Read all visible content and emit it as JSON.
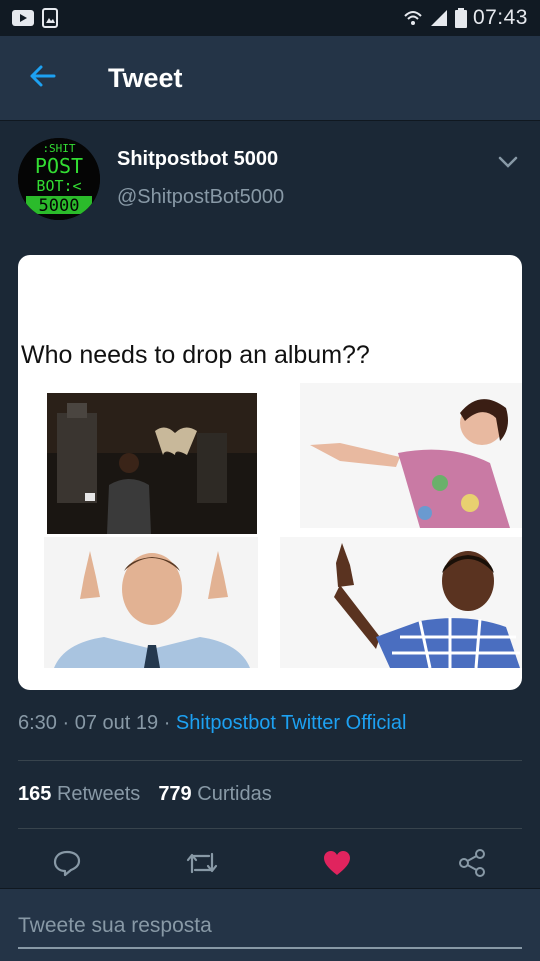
{
  "statusbar": {
    "time": "07:43",
    "icons": [
      "youtube-icon",
      "image-notification-icon",
      "wifi-icon",
      "signal-icon",
      "battery-icon"
    ]
  },
  "appbar": {
    "title": "Tweet",
    "back_icon": "arrow-left-icon",
    "accent": "#1da1f2"
  },
  "author": {
    "display_name": "Shitpostbot 5000",
    "handle": "@ShitpostBot5000",
    "avatar_text": [
      ":SHIT",
      "POST",
      "BOT:<",
      "5000"
    ]
  },
  "media": {
    "caption": "Who needs to drop an album??",
    "panels": [
      "man-with-moth-photo",
      "woman-pointing-photo",
      "man-pointing-up-photo",
      "boy-pointing-photo"
    ]
  },
  "meta": {
    "time": "6:30",
    "date": "07 out 19",
    "source": "Shitpostbot Twitter Official"
  },
  "stats": {
    "retweets_count": "165",
    "retweets_label": "Retweets",
    "likes_count": "779",
    "likes_label": "Curtidas"
  },
  "actions": {
    "icons": [
      "comment-icon",
      "retweet-icon",
      "heart-icon",
      "share-icon"
    ],
    "like_color": "#e0245e"
  },
  "reply": {
    "placeholder": "Tweete sua resposta"
  }
}
